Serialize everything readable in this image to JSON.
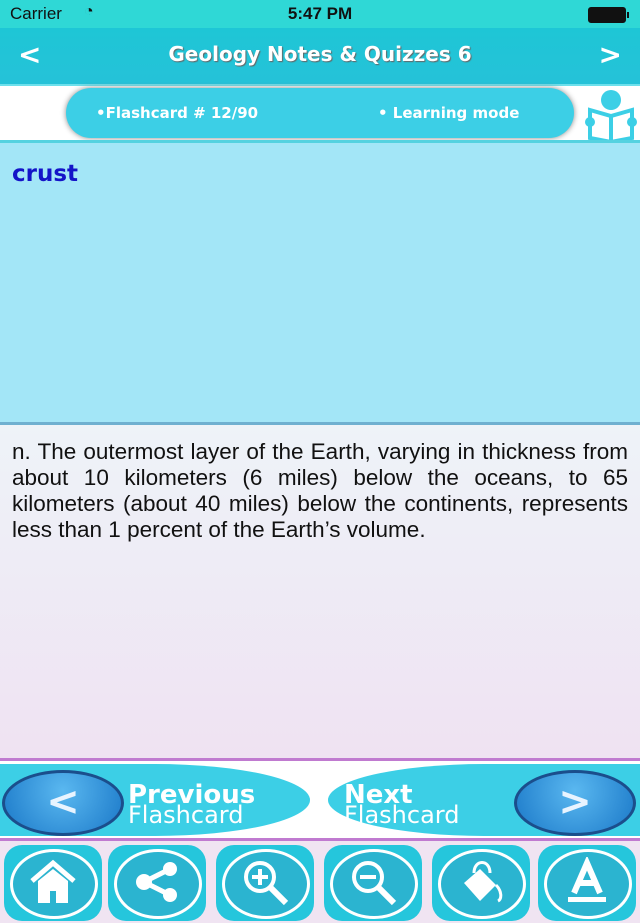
{
  "status_bar": {
    "carrier": "Carrier",
    "time": "5:47 PM"
  },
  "nav": {
    "title": "Geology Notes & Quizzes 6",
    "back": "<",
    "forward": ">"
  },
  "info": {
    "flashcard": "•Flashcard #  12/90",
    "mode": "• Learning mode"
  },
  "card": {
    "term": "crust",
    "definition": "n. The outermost layer of the Earth, varying in thickness from about 10 kilometers (6 miles) below the oceans, to 65 kilometers (about 40 miles) below the continents, represents less than 1 percent of the Earth’s volume."
  },
  "buttons": {
    "previous": {
      "label": "Previous",
      "sub": "Flashcard",
      "icon": "<"
    },
    "next": {
      "label": "Next",
      "sub": "Flashcard",
      "icon": ">"
    }
  },
  "toolbar": [
    "home-icon",
    "share-icon",
    "zoom-in-icon",
    "zoom-out-icon",
    "paint-bucket-icon",
    "font-icon"
  ]
}
